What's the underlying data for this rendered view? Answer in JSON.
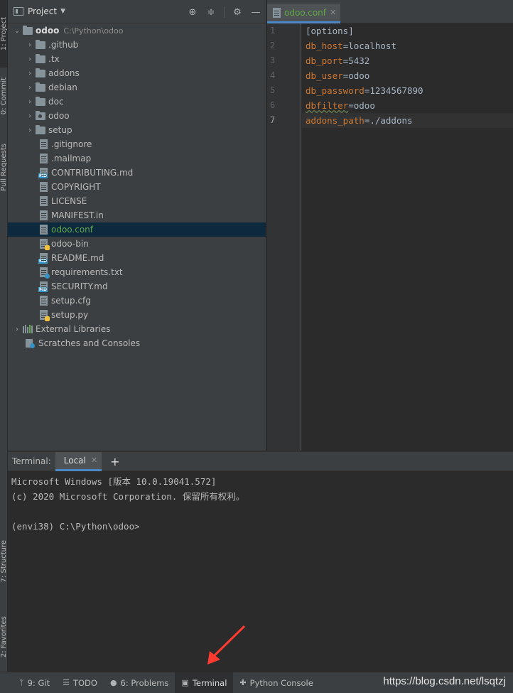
{
  "left_stripe": {
    "tabs": [
      {
        "label": "1: Project"
      },
      {
        "label": "0: Commit"
      },
      {
        "label": "Pull Requests"
      },
      {
        "label": "7: Structure"
      },
      {
        "label": "2: Favorites"
      }
    ]
  },
  "project": {
    "title": "Project",
    "root": {
      "name": "odoo",
      "path": "C:\\Python\\odoo"
    },
    "folders": [
      ".github",
      ".tx",
      "addons",
      "debian",
      "doc",
      "odoo",
      "setup"
    ],
    "files": [
      ".gitignore",
      ".mailmap",
      "CONTRIBUTING.md",
      "COPYRIGHT",
      "LICENSE",
      "MANIFEST.in",
      "odoo.conf",
      "odoo-bin",
      "README.md",
      "requirements.txt",
      "SECURITY.md",
      "setup.cfg",
      "setup.py"
    ],
    "selected_file": "odoo.conf",
    "external_libraries": "External Libraries",
    "scratches": "Scratches and Consoles"
  },
  "editor": {
    "tab_name": "odoo.conf",
    "line_numbers": [
      "1",
      "2",
      "3",
      "4",
      "5",
      "6",
      "7"
    ],
    "lines": [
      {
        "section": "[options]"
      },
      {
        "key": "db_host",
        "value": "localhost"
      },
      {
        "key": "db_port",
        "value": "5432"
      },
      {
        "key": "db_user",
        "value": "odoo"
      },
      {
        "key": "db_password",
        "value": "1234567890"
      },
      {
        "key": "dbfilter",
        "value": "odoo"
      },
      {
        "key": "addons_path",
        "value": "./addons"
      }
    ],
    "current_line": 7
  },
  "terminal": {
    "title": "Terminal:",
    "tab": "Local",
    "lines": [
      "Microsoft Windows [版本 10.0.19041.572]",
      "(c) 2020 Microsoft Corporation. 保留所有权利。",
      "",
      "(envi38) C:\\Python\\odoo>"
    ]
  },
  "bottom_bar": {
    "tabs": [
      "9: Git",
      "TODO",
      "6: Problems",
      "Terminal",
      "Python Console"
    ],
    "active": "Terminal",
    "watermark": "https://blog.csdn.net/lsqtzj"
  },
  "colors": {
    "accent": "#4a88c7",
    "key": "#cc7832",
    "selected_file": "#62a845",
    "annotation_arrow": "#ff3b30"
  }
}
